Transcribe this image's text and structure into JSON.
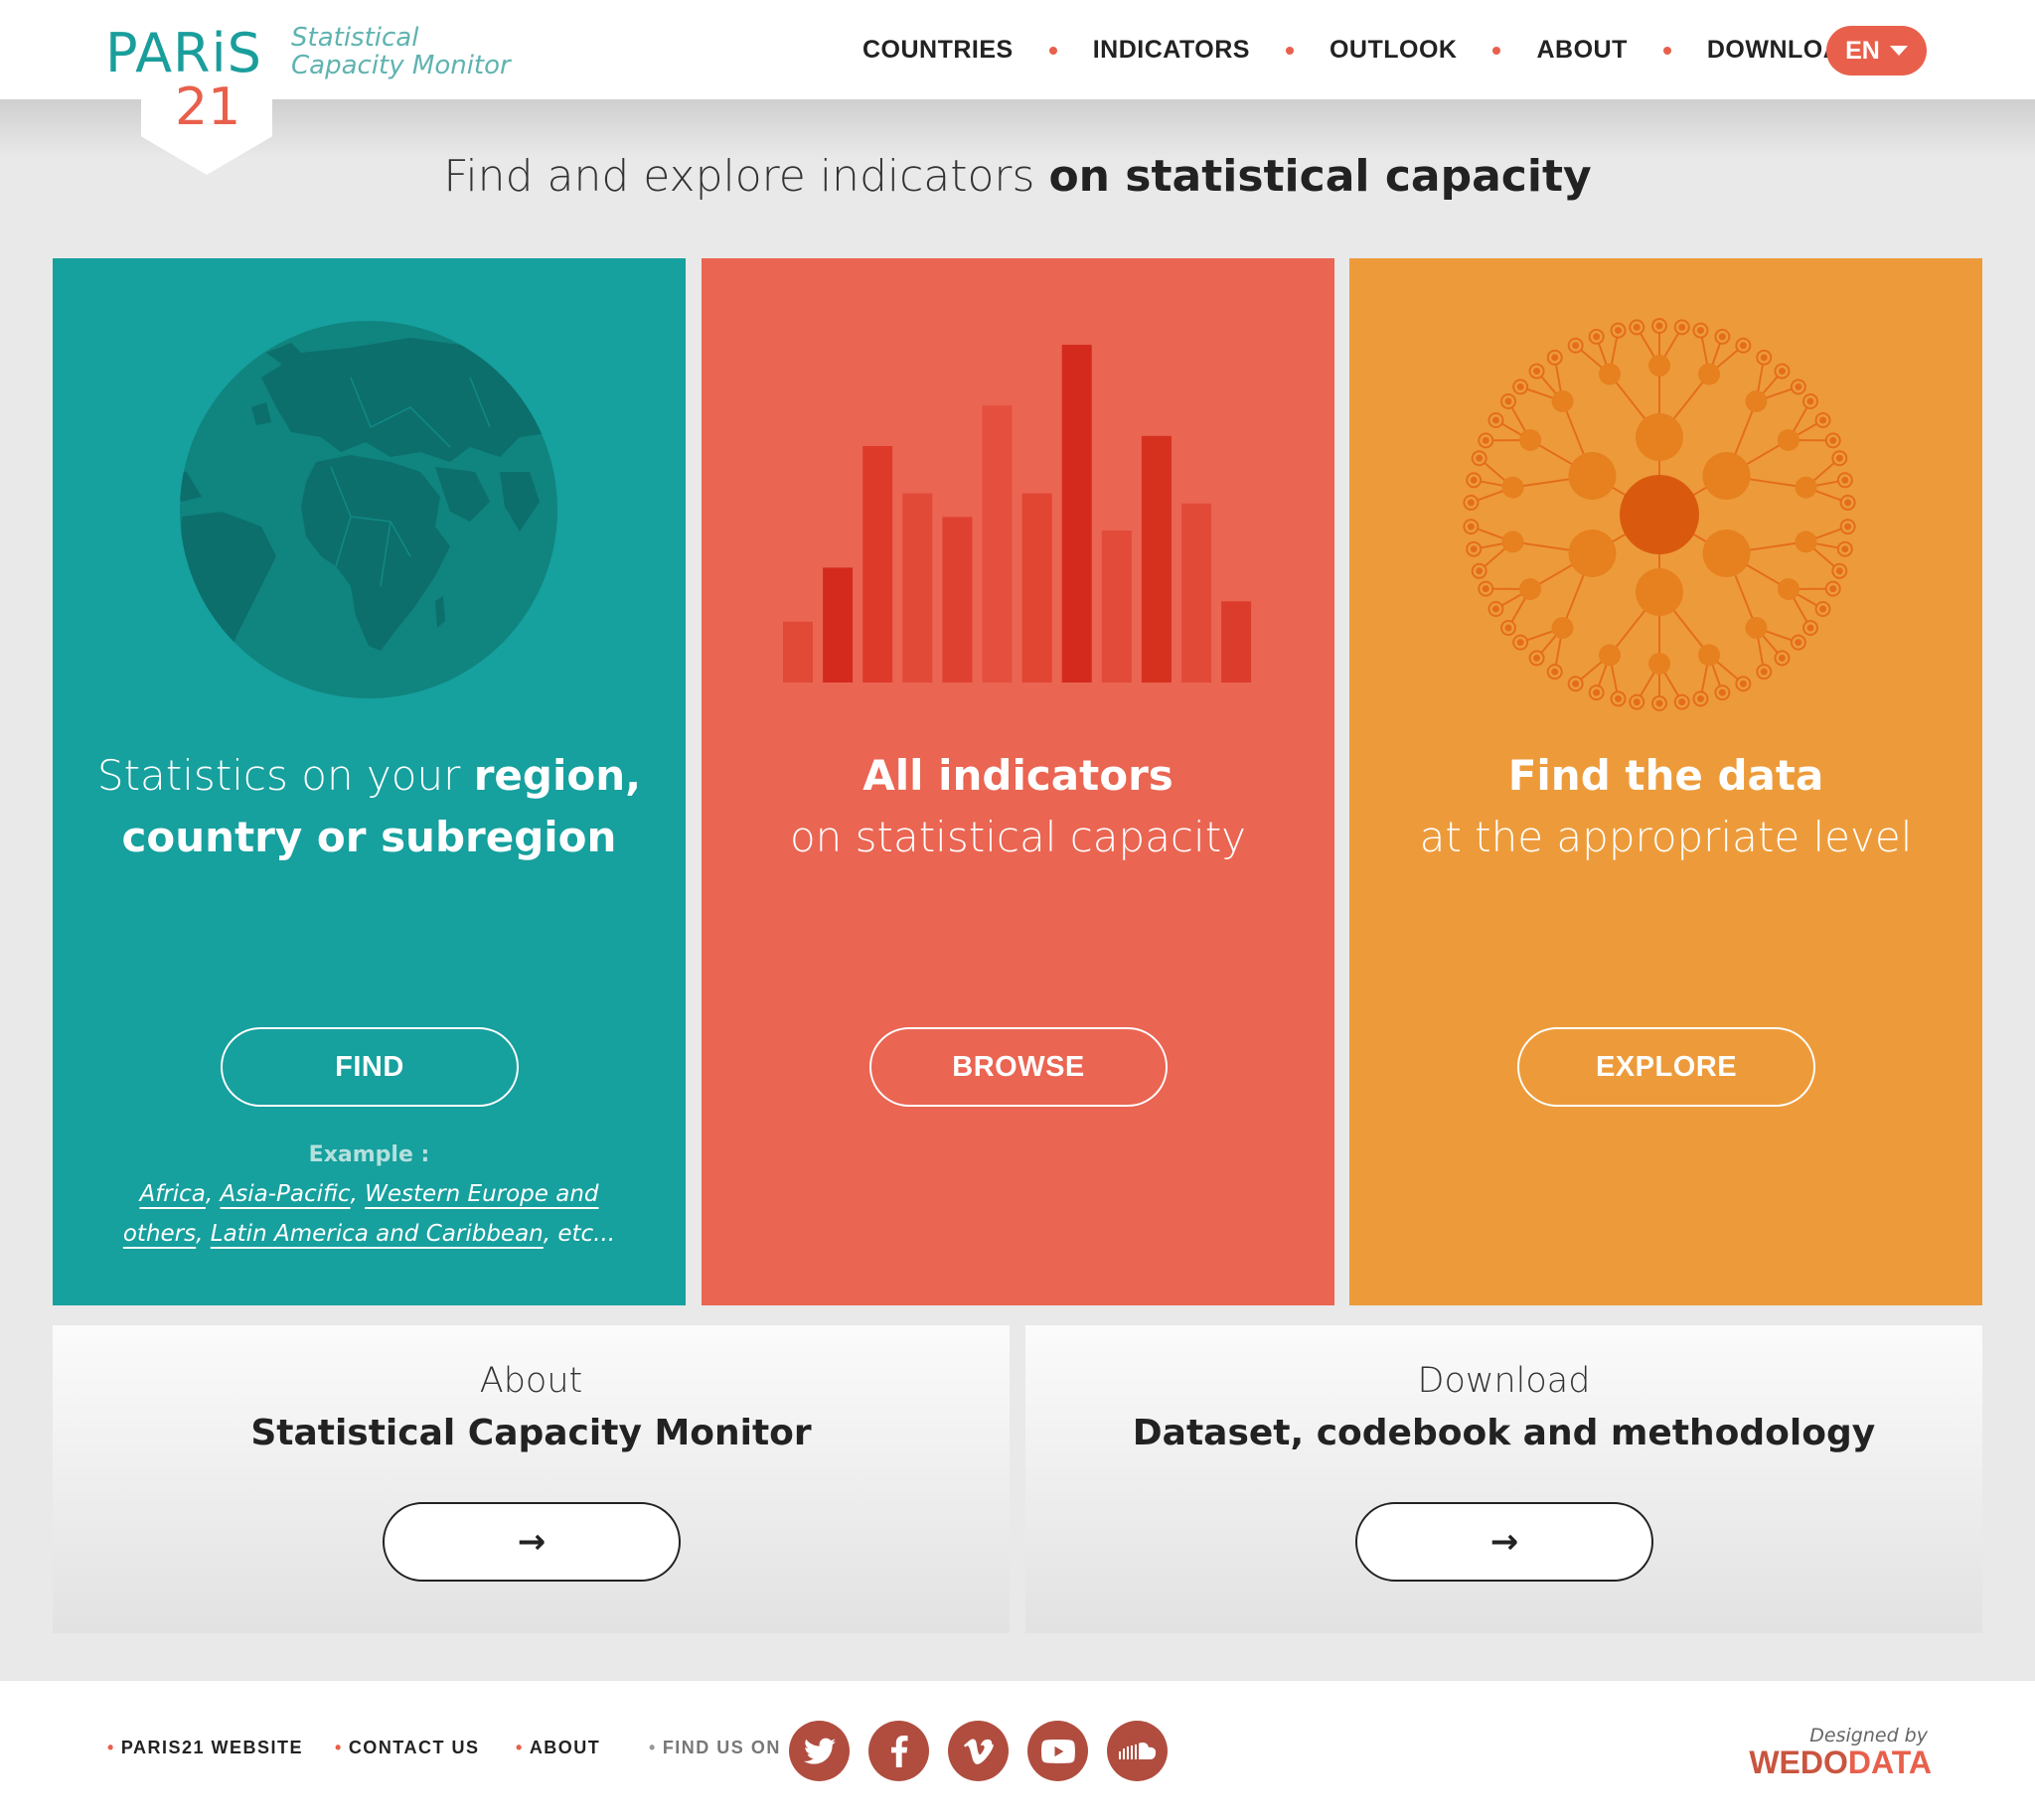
{
  "brand": {
    "logo_main": "PARiS",
    "logo_num": "21",
    "subtitle_line1": "Statistical",
    "subtitle_line2": "Capacity Monitor"
  },
  "nav": {
    "items": [
      "COUNTRIES",
      "INDICATORS",
      "OUTLOOK",
      "ABOUT",
      "DOWNLOAD"
    ],
    "language": "EN"
  },
  "headline": {
    "light": "Find and explore indicators ",
    "bold": "on statistical capacity"
  },
  "cards": [
    {
      "title_light": "Statistics on your ",
      "title_bold_1": "region,",
      "title_bold_2": "country or subregion",
      "button": "FIND",
      "example_label": "Example :",
      "examples": [
        "Africa",
        "Asia-Pacific",
        "Western Europe and others",
        "Latin America and Caribbean"
      ],
      "example_suffix": ", etc..."
    },
    {
      "title_bold": "All indicators",
      "title_light": "on statistical capacity",
      "button": "BROWSE",
      "bars": [
        0.18,
        0.34,
        0.7,
        0.56,
        0.49,
        0.82,
        0.56,
        1.0,
        0.45,
        0.73,
        0.53,
        0.24
      ]
    },
    {
      "title_bold": "Find the data",
      "title_light": "at the appropriate level",
      "button": "EXPLORE"
    }
  ],
  "panels": [
    {
      "kicker": "About",
      "title": "Statistical Capacity Monitor",
      "button": "→"
    },
    {
      "kicker": "Download",
      "title": "Dataset, codebook and methodology",
      "button": "→"
    }
  ],
  "footer": {
    "links": [
      "PARIS21 WEBSITE",
      "CONTACT US",
      "ABOUT"
    ],
    "find_us": "FIND US ON",
    "social": [
      "twitter-icon",
      "facebook-icon",
      "vimeo-icon",
      "youtube-icon",
      "soundcloud-icon"
    ],
    "designed_by": "Designed by",
    "designer_a": "WEDO",
    "designer_b": "DATA"
  },
  "colors": {
    "teal": "#16a09e",
    "red": "#ea6552",
    "orange": "#ed9b3a",
    "accent": "#e8604c"
  }
}
